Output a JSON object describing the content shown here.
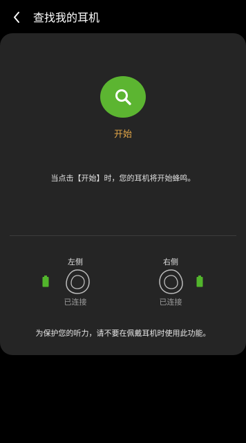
{
  "header": {
    "title": "查找我的耳机",
    "back_icon": "chevron-left-icon"
  },
  "start": {
    "label": "开始",
    "icon": "search-icon",
    "color": "#5cb531",
    "label_color": "#e1a547"
  },
  "instruction": "当点击【开始】时，您的耳机将开始蜂鸣。",
  "earbuds": {
    "left": {
      "label": "左侧",
      "status": "已连接",
      "icon": "left-earbud-icon",
      "battery_icon": "battery-icon"
    },
    "right": {
      "label": "右侧",
      "status": "已连接",
      "icon": "right-earbud-icon",
      "battery_icon": "battery-icon"
    },
    "battery_color": "#52b52c"
  },
  "warning": "为保护您的听力，请不要在佩戴耳机时使用此功能。"
}
